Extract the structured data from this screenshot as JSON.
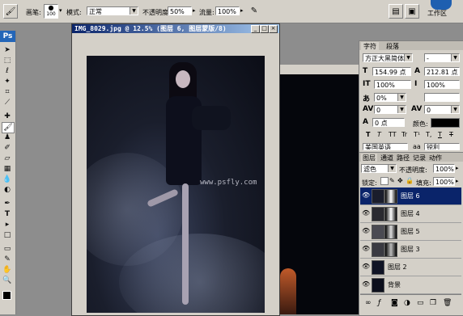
{
  "options_bar": {
    "brush_label": "画笔:",
    "brush_size": "100",
    "mode_label": "模式:",
    "mode_value": "正常",
    "opacity_label": "不透明度:",
    "opacity_value": "50%",
    "flow_label": "流量:",
    "flow_value": "100%",
    "workspace_label": "工作区"
  },
  "document": {
    "title": "IMG_8029.jpg @ 12.5% (图层 6, 图层蒙版/8)",
    "watermark": "www.psfly.com"
  },
  "char_panel": {
    "tabs": [
      "字符",
      "段落"
    ],
    "font_family": "方正大黑简体",
    "font_style": "-",
    "font_size": "154.99 点",
    "leading": "212.81 点",
    "vscale": "100%",
    "hscale": "100%",
    "tracking_pct": "0%",
    "kerning": "0",
    "tracking": "0",
    "baseline": "0 点",
    "color_label": "颜色:",
    "style_buttons": [
      "T",
      "T",
      "TT",
      "Tr",
      "T¹",
      "T,",
      "T",
      "T"
    ],
    "language": "美国英语",
    "aa_label": "aa",
    "aa_value": "锐利"
  },
  "layers_panel": {
    "tabs": [
      "图层",
      "通道",
      "路径",
      "记录",
      "动作"
    ],
    "blend_mode": "滤色",
    "opacity_label": "不透明度:",
    "opacity_value": "100%",
    "lock_label": "锁定:",
    "fill_label": "填充:",
    "fill_value": "100%",
    "layers": [
      {
        "name": "图层 6",
        "selected": true
      },
      {
        "name": "图层 4",
        "selected": false
      },
      {
        "name": "图层 5",
        "selected": false
      },
      {
        "name": "图层 3",
        "selected": false
      },
      {
        "name": "图层 2",
        "selected": false
      },
      {
        "name": "背景",
        "selected": false
      }
    ]
  },
  "toolbox": {
    "logo": "Ps"
  },
  "colors": {
    "title_bar": "#0a246a",
    "panel_bg": "#d4d0c8",
    "workspace": "#8d8d8d"
  }
}
